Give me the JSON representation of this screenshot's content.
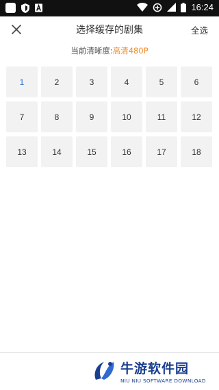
{
  "status_bar": {
    "time": "16:24",
    "left_icons": [
      "square-icon",
      "shield-icon",
      "letter-a-icon"
    ],
    "right_icons": [
      "wifi-icon",
      "battery-saver-icon",
      "signal-icon",
      "battery-icon"
    ],
    "letter_a": "A"
  },
  "header": {
    "close_icon": "close-icon",
    "title": "选择缓存的剧集",
    "select_all": "全选"
  },
  "quality": {
    "label": "当前清晰度:",
    "value": "高清480P",
    "value_color": "#f08c2a"
  },
  "episodes": [
    "1",
    "2",
    "3",
    "4",
    "5",
    "6",
    "7",
    "8",
    "9",
    "10",
    "11",
    "12",
    "13",
    "14",
    "15",
    "16",
    "17",
    "18"
  ],
  "active_episode_color": "#2b6fcf",
  "watermark": {
    "logo_icon": "niuyou-logo-icon",
    "cn": "牛游软件园",
    "en": "NIU NIU SOFTWARE DOWNLOAD"
  }
}
